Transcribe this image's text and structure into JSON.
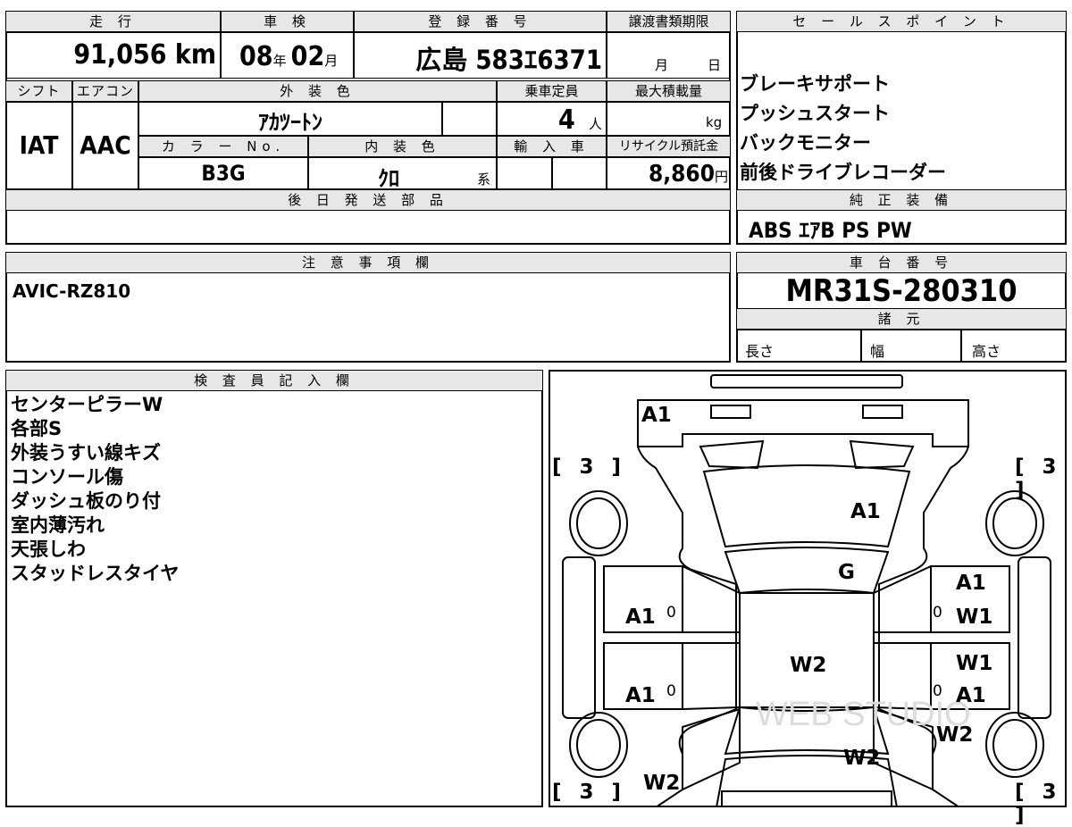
{
  "top_grid": {
    "mileage": {
      "header": "走 行",
      "value": "91,056",
      "unit": "km"
    },
    "inspection": {
      "header": "車 検",
      "year": "08",
      "year_unit": "年",
      "month": "02",
      "month_unit": "月"
    },
    "registration": {
      "header": "登 録 番 号",
      "region": "広島",
      "class_no": "583",
      "kana": "ｴ",
      "number": "6371"
    },
    "transfer_deadline": {
      "header": "譲渡書類期限",
      "month_unit": "月",
      "day_unit": "日"
    },
    "shift": {
      "header": "シフト",
      "value": "IAT"
    },
    "aircon": {
      "header": "エアコン",
      "value": "AAC"
    },
    "exterior_color": {
      "header": "外 装 色",
      "value": "ｱｶﾂｰﾄﾝ"
    },
    "capacity": {
      "header": "乗車定員",
      "value": "4",
      "unit": "人"
    },
    "max_load": {
      "header": "最大積載量",
      "unit": "kg"
    },
    "color_no": {
      "header": "カ ラ ー No.",
      "value": "B3G"
    },
    "interior_color": {
      "header": "内 装 色",
      "value": "ｸﾛ",
      "suffix": "系"
    },
    "import": {
      "header": "輸 入 車"
    },
    "recycle": {
      "header": "リサイクル預託金",
      "value": "8,860",
      "unit": "円"
    },
    "later_parts": {
      "header": "後 日 発 送 部 品",
      "value": ""
    }
  },
  "sales_points": {
    "header": "セ ー ル ス ポ イ ン ト",
    "items": [
      "ブレーキサポート",
      "プッシュスタート",
      "バックモニター",
      "前後ドライブレコーダー"
    ]
  },
  "genuine_equipment": {
    "header": "純 正 装 備",
    "value": "ABS ｴｱB PS PW"
  },
  "notes": {
    "header": "注 意 事 項 欄",
    "value": "AVIC-RZ810"
  },
  "chassis": {
    "header": "車 台 番 号",
    "value": "MR31S-280310"
  },
  "specs": {
    "header": "諸 元",
    "length": "長さ",
    "width": "幅",
    "height": "高さ"
  },
  "inspector": {
    "header": "検 査 員 記 入 欄",
    "items": [
      "センターピラーW",
      "各部S",
      "外装うすい線キズ",
      "コンソール傷",
      "ダッシュ板のり付",
      "室内薄汚れ",
      "天張しわ",
      "スタッドレスタイヤ"
    ]
  },
  "diagram": {
    "tire_bracket_fl": "[ 3 ]",
    "tire_bracket_fr": "[ 3 ]",
    "tire_bracket_rl": "[ 3 ]",
    "tire_bracket_rr": "[ 3 ]",
    "marks": {
      "front_bumper": "A1",
      "hood": "A1",
      "windshield": "G",
      "front_door_left": "A1",
      "rear_door_left": "A1",
      "right_fender": "A1",
      "front_door_right": "W1",
      "rear_door_right_w": "W1",
      "rear_door_right_a": "A1",
      "roof": "W2",
      "rear_quarter_right": "W2",
      "rear_quarter_left": "W2",
      "tailgate": "W2",
      "sill_left_1": "0",
      "sill_left_2": "0",
      "sill_right_1": "0",
      "sill_right_2": "0"
    },
    "watermark": "WEB STUDIO"
  }
}
